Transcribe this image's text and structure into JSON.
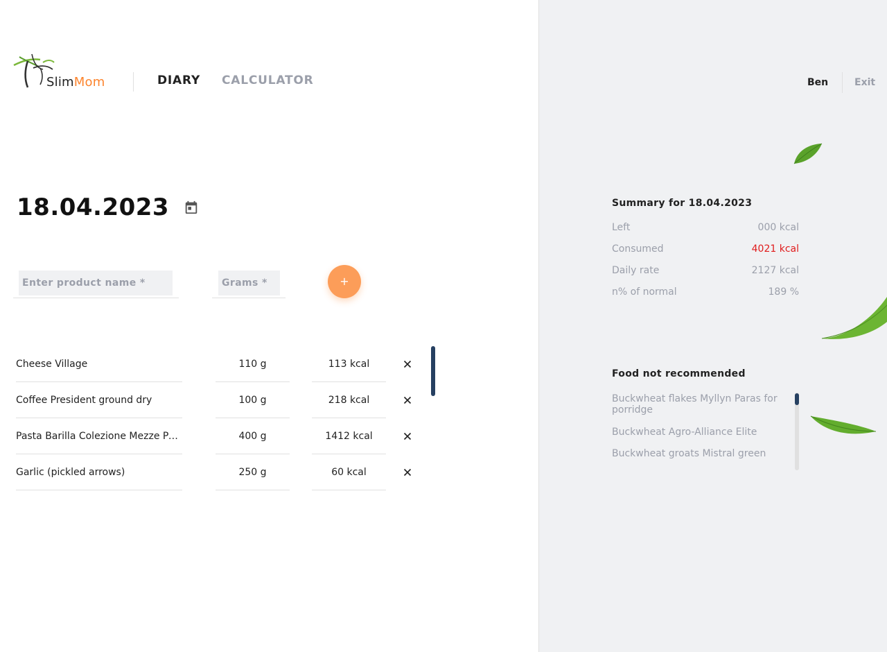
{
  "header": {
    "logo": {
      "slim": "Slim",
      "mom": "Mom"
    },
    "nav": {
      "diary": "DIARY",
      "calculator": "CALCULATOR"
    },
    "user": {
      "name": "Ben",
      "exit": "Exit"
    }
  },
  "diary": {
    "date": "18.04.2023",
    "form": {
      "product_placeholder": "Enter product name *",
      "grams_placeholder": "Grams *",
      "add_label": "+"
    },
    "items": [
      {
        "name": "Cheese Village",
        "grams": "110 g",
        "kcal": "113 kcal"
      },
      {
        "name": "Coffee President ground dry",
        "grams": "100 g",
        "kcal": "218 kcal"
      },
      {
        "name": "Pasta Barilla Colezione Mezze Penne",
        "grams": "400 g",
        "kcal": "1412 kcal"
      },
      {
        "name": "Garlic (pickled arrows)",
        "grams": "250 g",
        "kcal": "60 kcal"
      }
    ],
    "delete_icon": "close-icon"
  },
  "summary": {
    "title": "Summary for 18.04.2023",
    "rows": [
      {
        "label": "Left",
        "value": "000 kcal"
      },
      {
        "label": "Consumed",
        "value": "4021 kcal"
      },
      {
        "label": "Daily rate",
        "value": "2127 kcal"
      },
      {
        "label": "n% of normal",
        "value": "189 %"
      }
    ]
  },
  "not_recommended": {
    "title": "Food not recommended",
    "items": [
      "Buckwheat flakes Myllyn Paras for porridge",
      "Buckwheat Agro-Alliance Elite",
      "Buckwheat groats Mistral green"
    ]
  },
  "colors": {
    "accent": "#fc842d",
    "button": "#fc9d59",
    "text_dark": "#212121",
    "text_muted": "#9b9faa",
    "danger": "#e01b1b",
    "scroll": "#264061",
    "panel_bg": "#f0f1f3"
  }
}
